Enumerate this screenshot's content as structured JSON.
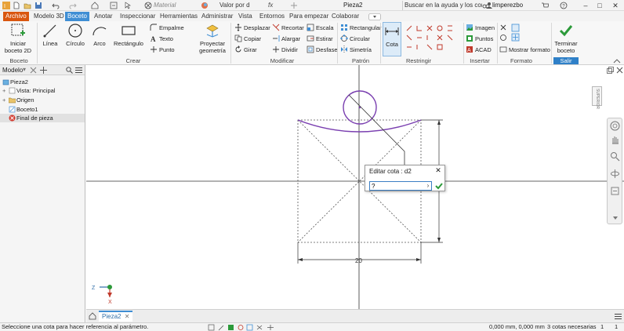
{
  "titlebar": {
    "material_placeholder": "Material",
    "appearance_value": "Valor por d",
    "fx_label": "fx",
    "doc_title": "Pieza2",
    "help_search": "Buscar en la ayuda y los comanc",
    "user_name": "limperezbo"
  },
  "tabs": [
    "Archivo",
    "Modelo 3D",
    "Boceto",
    "Anotar",
    "Inspeccionar",
    "Herramientas",
    "Administrar",
    "Vista",
    "Entornos",
    "Para empezar",
    "Colaborar"
  ],
  "ribbon": {
    "boceto_panel": {
      "label": "Boceto",
      "start_sketch_line1": "Iniciar",
      "start_sketch_line2": "boceto 2D"
    },
    "crear_panel": {
      "label": "Crear",
      "line": "Línea",
      "circle": "Círculo",
      "arc": "Arco",
      "rectangle": "Rectángulo",
      "fillet": "Empalme",
      "text": "Texto",
      "point": "Punto",
      "project_line1": "Proyectar",
      "project_line2": "geometría"
    },
    "modificar_panel": {
      "label": "Modificar",
      "move": "Desplazar",
      "copy": "Copiar",
      "rotate": "Girar",
      "trim": "Recortar",
      "extend": "Alargar",
      "split": "Dividir",
      "scale": "Escala",
      "stretch": "Estirar",
      "offset": "Desfase"
    },
    "patron_panel": {
      "label": "Patrón",
      "rectangular": "Rectangular",
      "circular": "Circular",
      "mirror": "Simetría"
    },
    "restringir_panel": {
      "label": "Restringir",
      "dimension": "Cota"
    },
    "insertar_panel": {
      "label": "Insertar",
      "image": "Imagen",
      "points": "Puntos",
      "acad": "ACAD"
    },
    "formato_panel": {
      "label": "Formato",
      "show_format": "Mostrar formato"
    },
    "salir_panel": {
      "label": "Salir",
      "finish_line1": "Terminar",
      "finish_line2": "boceto"
    }
  },
  "browser": {
    "tab_label": "Modelo",
    "tree": [
      "Pieza2",
      "Vista: Principal",
      "Origen",
      "Boceto1",
      "Final de pieza"
    ]
  },
  "canvas": {
    "viewcube_label": "SUPERIOR",
    "dimension_text": "20",
    "axis_x": "X",
    "axis_z": "Z"
  },
  "dim_dialog": {
    "title": "Editar cota : d2",
    "value": "?"
  },
  "doc_tab": {
    "label": "Pieza2"
  },
  "status": {
    "prompt": "Seleccione una cota para hacer referencia al parámetro.",
    "coords": "0,000 mm, 0,000 mm",
    "constraints": "3 cotas necesarias",
    "page1": "1",
    "page2": "1"
  },
  "colors": {
    "sketch_purple": "#7a3fb0",
    "accent_blue": "#3f8ed4",
    "file_tab_orange": "#d9560f",
    "accept_green": "#2c9a3a"
  }
}
